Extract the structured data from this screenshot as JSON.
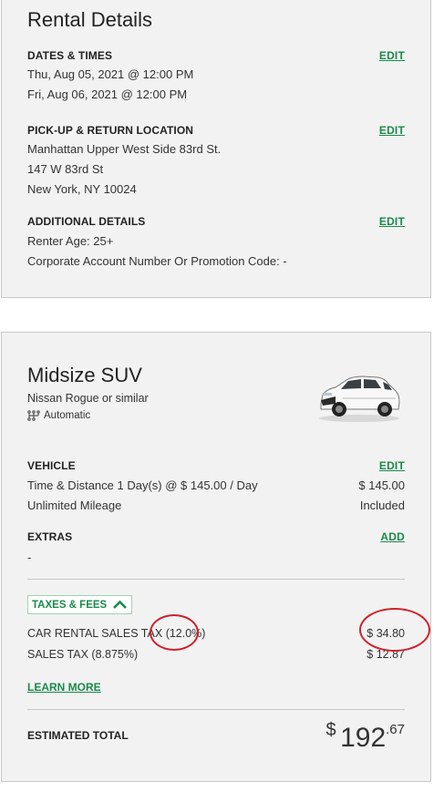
{
  "rental_details": {
    "title": "Rental Details",
    "dates": {
      "heading": "DATES & TIMES",
      "edit_label": "EDIT",
      "pickup": "Thu, Aug 05, 2021 @ 12:00 PM",
      "return": "Fri, Aug 06, 2021 @ 12:00 PM"
    },
    "location": {
      "heading": "PICK-UP & RETURN LOCATION",
      "edit_label": "EDIT",
      "name": "Manhattan Upper West Side 83rd St.",
      "street": "147 W 83rd St",
      "city": "New York, NY 10024"
    },
    "additional": {
      "heading": "ADDITIONAL DETAILS",
      "edit_label": "EDIT",
      "renter_age": "Renter Age: 25+",
      "corporate": "Corporate Account Number Or Promotion Code: -"
    }
  },
  "vehicle_card": {
    "title": "Midsize SUV",
    "model": "Nissan Rogue or similar",
    "transmission": "Automatic",
    "vehicle": {
      "heading": "VEHICLE",
      "edit_label": "EDIT",
      "time_distance": "Time & Distance 1 Day(s) @ $ 145.00 / Day",
      "time_distance_amount": "$ 145.00",
      "mileage": "Unlimited Mileage",
      "mileage_amount": "Included"
    },
    "extras": {
      "heading": "EXTRAS",
      "add_label": "ADD",
      "value": "-"
    },
    "taxes": {
      "toggle_label": "TAXES & FEES",
      "car_rental_tax_label": "CAR RENTAL SALES TAX",
      "car_rental_tax_rate": "(12.0%)",
      "car_rental_tax_amount": "$ 34.80",
      "sales_tax_label": "SALES TAX (8.875%)",
      "sales_tax_amount": "$ 12.87",
      "learn_more_label": "LEARN MORE"
    },
    "total": {
      "label": "ESTIMATED TOTAL",
      "currency": "$",
      "whole": "192",
      "cents": ".67"
    }
  },
  "colors": {
    "accent_green": "#1a8a4a",
    "annotation_red": "#d0202a",
    "card_background": "#f2f2f2"
  },
  "icons": [
    "transmission-icon",
    "chevron-up-icon",
    "car-image"
  ]
}
